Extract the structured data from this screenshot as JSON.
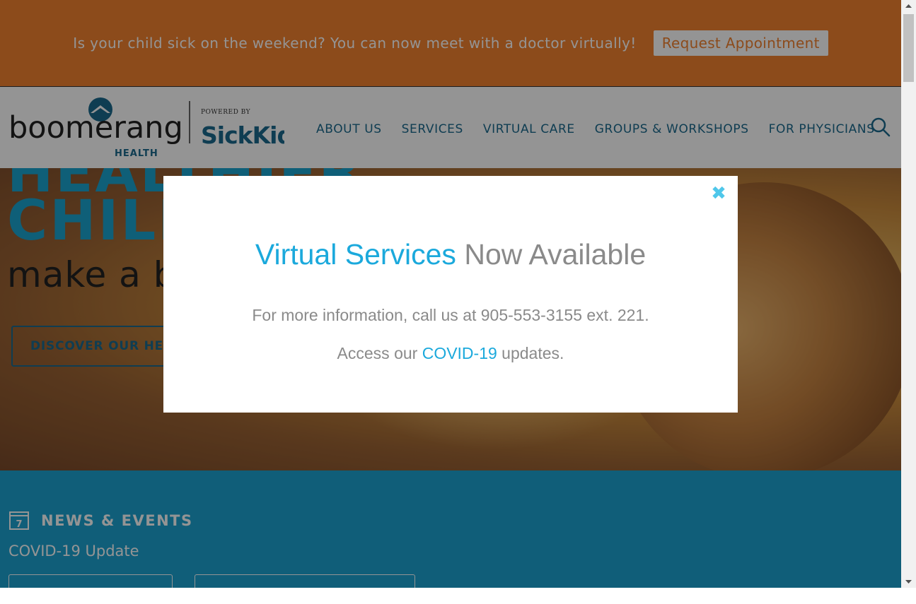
{
  "banner": {
    "text": "Is your child sick on the weekend? You can now meet with a doctor virtually!",
    "button": "Request Appointment"
  },
  "header": {
    "logo": {
      "brand": "boomerang",
      "brand_sub": "HEALTH",
      "powered_by": "POWERED BY",
      "partner": "SickKids"
    },
    "nav": [
      "ABOUT US",
      "SERVICES",
      "VIRTUAL CARE",
      "GROUPS & WORKSHOPS",
      "FOR PHYSICIANS"
    ]
  },
  "hero": {
    "line1": "HEALTHIER",
    "line2": "CHILDREN",
    "line3": "make a b",
    "button": "DISCOVER OUR HEA"
  },
  "news": {
    "calendar_day": "7",
    "title": "NEWS & EVENTS",
    "subtitle": "COVID-19 Update"
  },
  "modal": {
    "close": "✖",
    "title_blue": "Virtual Services",
    "title_grey": " Now Available",
    "info": "For more information, call us at 905-553-3155 ext. 221.",
    "access_prefix": "Access our ",
    "access_link": "COVID-19",
    "access_suffix": " updates."
  },
  "colors": {
    "banner": "#f28130",
    "nav": "#1b6a8d",
    "accent": "#1ba9dc",
    "news_bg": "#1da3d1"
  }
}
